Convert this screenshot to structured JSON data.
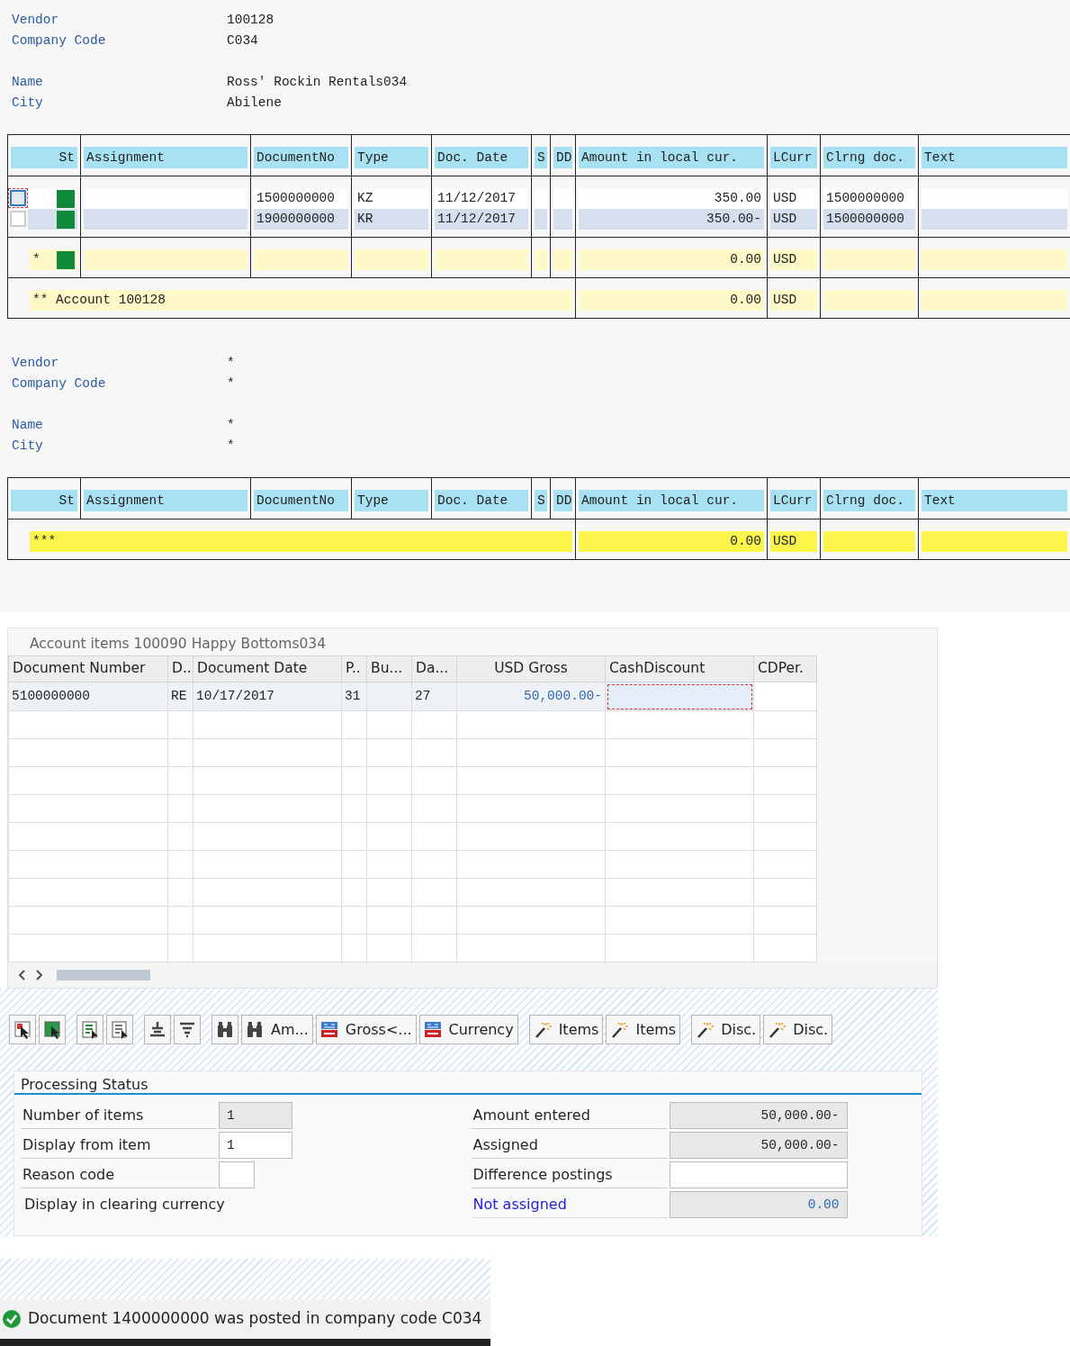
{
  "reports": [
    {
      "field_groups": [
        [
          {
            "label": "Vendor",
            "value": "100128"
          },
          {
            "label": "Company Code",
            "value": "C034"
          }
        ],
        [
          {
            "label": "Name",
            "value": "Ross' Rockin Rentals034"
          },
          {
            "label": "City",
            "value": "Abilene"
          }
        ]
      ],
      "table": {
        "columns": [
          "St",
          "Assignment",
          "DocumentNo",
          "Type",
          "Doc. Date",
          "S",
          "DD",
          "Amount in local cur.",
          "LCurr",
          "Clrng doc.",
          "Text"
        ],
        "items": [
          {
            "focused": true,
            "cleared": true,
            "document_no": "1500000000",
            "type": "KZ",
            "doc_date": "11/12/2017",
            "amount": "350.00",
            "currency": "USD",
            "clearing_doc": "1500000000"
          },
          {
            "focused": false,
            "cleared": true,
            "document_no": "1900000000",
            "type": "KR",
            "doc_date": "11/12/2017",
            "amount": "350.00-",
            "currency": "USD",
            "clearing_doc": "1500000000"
          }
        ],
        "subtotal": {
          "marker": "*",
          "cleared": true,
          "amount": "0.00",
          "currency": "USD"
        },
        "total": {
          "kind": "account",
          "label": "** Account 100128",
          "amount": "0.00",
          "currency": "USD"
        }
      }
    },
    {
      "field_groups": [
        [
          {
            "label": "Vendor",
            "value": "*"
          },
          {
            "label": "Company Code",
            "value": "*"
          }
        ],
        [
          {
            "label": "Name",
            "value": "*"
          },
          {
            "label": "City",
            "value": "*"
          }
        ]
      ],
      "table": {
        "columns": [
          "St",
          "Assignment",
          "DocumentNo",
          "Type",
          "Doc. Date",
          "S",
          "DD",
          "Amount in local cur.",
          "LCurr",
          "Clrng doc.",
          "Text"
        ],
        "total": {
          "kind": "grand",
          "label": "***",
          "amount": "0.00",
          "currency": "USD"
        }
      }
    }
  ],
  "line_items": {
    "title": "Account items 100090 Happy Bottoms034",
    "columns": [
      "Document Number",
      "D..",
      "Document Date",
      "P..",
      "Bu...",
      "Da...",
      "USD Gross",
      "CashDiscount",
      "CDPer."
    ],
    "rows": [
      {
        "cells": [
          {
            "text": "5100000000",
            "focused": false
          },
          {
            "text": "RE",
            "focused": false
          },
          {
            "text": "10/17/2017",
            "focused": false
          },
          {
            "text": "31",
            "focused": false
          },
          {
            "focused": false
          },
          {
            "text": "27",
            "focused": false
          },
          {
            "text": "50,000.00-",
            "focused": false
          },
          {
            "focused": true
          },
          {
            "focused": false
          }
        ]
      }
    ]
  },
  "toolbar": [
    [
      {
        "kind": "select-all"
      },
      {
        "kind": "deselect-all"
      }
    ],
    [
      {
        "kind": "select-block"
      },
      {
        "kind": "deselect-block"
      }
    ],
    [
      {
        "kind": "sort"
      },
      {
        "kind": "filter"
      }
    ],
    [
      {
        "kind": "find"
      },
      {
        "kind": "find",
        "label": "Am..."
      },
      {
        "kind": "money",
        "label": "Gross<..."
      },
      {
        "kind": "money",
        "label": "Currency"
      }
    ],
    [
      {
        "kind": "wand",
        "label": "Items"
      },
      {
        "kind": "wand",
        "label": "Items"
      }
    ],
    [
      {
        "kind": "wand",
        "label": "Disc."
      },
      {
        "kind": "wand",
        "label": "Disc."
      }
    ]
  ],
  "processing_status": {
    "title": "Processing Status",
    "left": [
      {
        "label": "Number of items",
        "kind": "readonly",
        "value": "1",
        "linked": false
      },
      {
        "label": "Display from item",
        "kind": "input",
        "value": "1",
        "linked": false
      },
      {
        "label": "Reason code",
        "kind": "short-input",
        "linked": false
      },
      {
        "label": "Display in clearing currency",
        "kind": "label",
        "linked": false
      }
    ],
    "right": [
      {
        "label": "Amount entered",
        "kind": "readonly",
        "value": "50,000.00-",
        "linked": false
      },
      {
        "label": "Assigned",
        "kind": "readonly",
        "value": "50,000.00-",
        "linked": false
      },
      {
        "label": "Difference postings",
        "kind": "input",
        "linked": false
      },
      {
        "label": "Not assigned",
        "kind": "readonly",
        "value": "0.00",
        "linked": true
      }
    ]
  },
  "message": {
    "kind": "success",
    "text": "Document 1400000000 was posted in company code C034"
  }
}
